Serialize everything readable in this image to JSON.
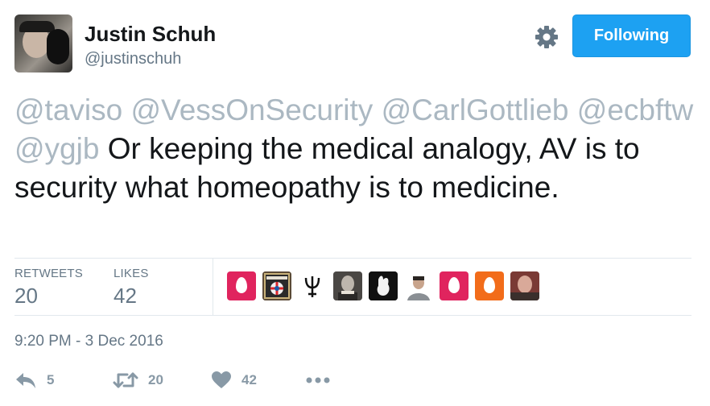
{
  "user": {
    "name": "Justin Schuh",
    "handle": "@justinschuh"
  },
  "follow_button": {
    "label": "Following",
    "color": "#1da1f2"
  },
  "tweet": {
    "mentions": [
      "@taviso",
      "@VessOnSecurity",
      "@CarlGottlieb",
      "@ecbftw",
      "@ygjb"
    ],
    "text": "Or keeping the medical analogy, AV is to security what homeopathy is to medicine."
  },
  "stats": {
    "retweets_label": "RETWEETS",
    "retweets": "20",
    "likes_label": "LIKES",
    "likes": "42"
  },
  "liker_avatars": [
    {
      "icon": "egg-avatar-icon",
      "color": "#e0245e"
    },
    {
      "icon": "patch-avatar-icon",
      "color": "#5b4a36"
    },
    {
      "icon": "trident-avatar-icon",
      "color": "#ffffff"
    },
    {
      "icon": "portrait-avatar-icon",
      "color": "#6d6a66"
    },
    {
      "icon": "rabbit-avatar-icon",
      "color": "#111111"
    },
    {
      "icon": "man-avatar-icon",
      "color": "#ffffff"
    },
    {
      "icon": "egg-avatar-icon",
      "color": "#e0245e"
    },
    {
      "icon": "egg-avatar-icon",
      "color": "#f26c1a"
    },
    {
      "icon": "face-avatar-icon",
      "color": "#9b4a43"
    }
  ],
  "timestamp": "9:20 PM - 3 Dec 2016",
  "actions": {
    "reply_count": "5",
    "retweet_count": "20",
    "like_count": "42"
  },
  "colors": {
    "text": "#14171a",
    "secondary": "#657786",
    "mention": "#abb8c2",
    "action": "#8899a6"
  }
}
